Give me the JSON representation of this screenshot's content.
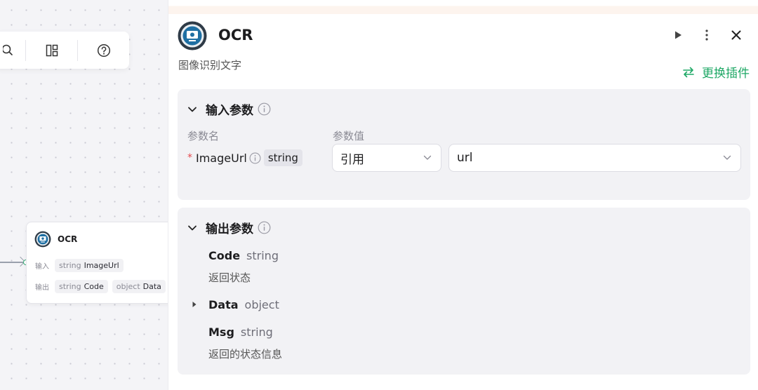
{
  "canvas": {
    "node": {
      "title": "OCR",
      "input_label": "输入",
      "input_type": "string",
      "input_name": "ImageUrl",
      "output_label": "输出",
      "outputs": [
        {
          "type": "string",
          "name": "Code"
        },
        {
          "type": "object",
          "name": "Data"
        }
      ]
    }
  },
  "panel": {
    "title": "OCR",
    "description": "图像识别文字",
    "replace_label": "更换插件",
    "input_section": {
      "title": "输入参数",
      "col_name_label": "参数名",
      "col_value_label": "参数值",
      "param": {
        "required_mark": "*",
        "name": "ImageUrl",
        "type": "string",
        "ref_mode": "引用",
        "value": "url"
      }
    },
    "output_section": {
      "title": "输出参数",
      "items": [
        {
          "name": "Code",
          "type": "string",
          "desc": "返回状态"
        },
        {
          "name": "Data",
          "type": "object",
          "desc": ""
        },
        {
          "name": "Msg",
          "type": "string",
          "desc": "返回的状态信息"
        }
      ]
    }
  },
  "colors": {
    "accent_green": "#1fa866",
    "required_red": "#e5484d"
  },
  "icons": {
    "toolbar": [
      "zoom-icon",
      "layout-icon",
      "help-icon"
    ],
    "header": [
      "run-icon",
      "more-icon",
      "close-icon"
    ]
  }
}
